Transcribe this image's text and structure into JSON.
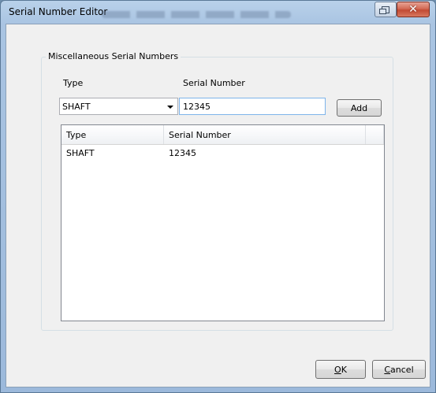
{
  "window": {
    "title": "Serial Number Editor"
  },
  "group": {
    "caption": "Miscellaneous Serial Numbers"
  },
  "form": {
    "type_label": "Type",
    "serial_label": "Serial Number",
    "type_value": "SHAFT",
    "serial_value": "12345",
    "add_label": "Add"
  },
  "list": {
    "columns": [
      "Type",
      "Serial Number"
    ],
    "rows": [
      {
        "type": "SHAFT",
        "serial": "12345"
      }
    ]
  },
  "buttons": {
    "ok_label": "OK",
    "ok_mnemonic": "O",
    "ok_rest": "K",
    "cancel_label": "Cancel",
    "cancel_mnemonic": "C",
    "cancel_rest": "ancel"
  },
  "icons": {
    "restore": "restore-icon",
    "close": "close-icon",
    "dropdown": "chevron-down-icon"
  },
  "colors": {
    "titlebar": "#a9c4e2",
    "close_button": "#c24a33",
    "client_bg": "#f0f0f0",
    "input_focus_border": "#7eb4ea"
  }
}
